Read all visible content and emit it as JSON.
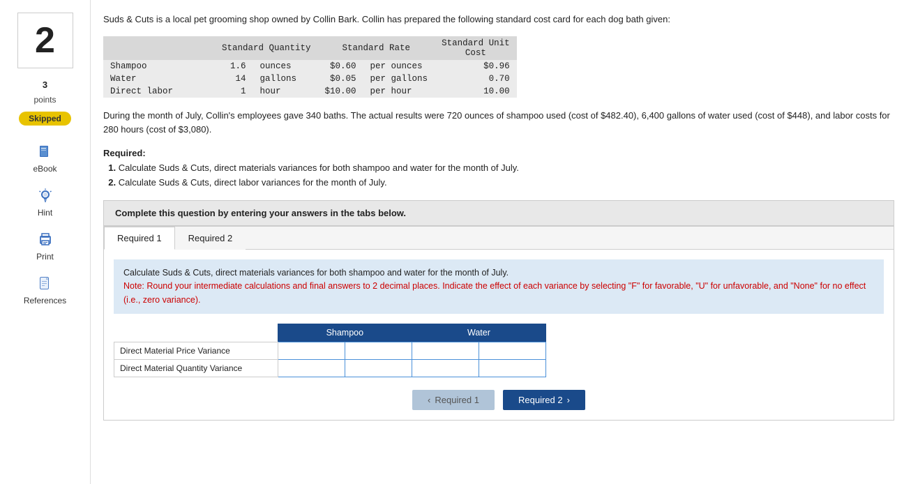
{
  "sidebar": {
    "question_number": "2",
    "points_value": "3",
    "points_label": "points",
    "skipped_label": "Skipped",
    "items": [
      {
        "id": "ebook",
        "label": "eBook",
        "icon": "book-icon"
      },
      {
        "id": "hint",
        "label": "Hint",
        "icon": "lightbulb-icon"
      },
      {
        "id": "print",
        "label": "Print",
        "icon": "print-icon"
      },
      {
        "id": "references",
        "label": "References",
        "icon": "document-icon"
      }
    ]
  },
  "main": {
    "question_text_1": "Suds & Cuts is a local pet grooming shop owned by Collin Bark. Collin has prepared the following standard cost card for each dog bath given:",
    "cost_table": {
      "headers": [
        "",
        "Standard Quantity",
        "",
        "Standard Rate",
        "",
        "Standard Unit Cost"
      ],
      "rows": [
        {
          "item": "Shampoo",
          "quantity": "1.6",
          "unit": "ounces",
          "rate": "$0.60",
          "rate_unit": "per ounces",
          "cost": "$0.96"
        },
        {
          "item": "Water",
          "quantity": "14",
          "unit": "gallons",
          "rate": "$0.05",
          "rate_unit": "per gallons",
          "cost": "0.70"
        },
        {
          "item": "Direct labor",
          "quantity": "1",
          "unit": "hour",
          "rate": "$10.00",
          "rate_unit": "per hour",
          "cost": "10.00"
        }
      ]
    },
    "scenario_text": "During the month of July, Collin's employees gave 340 baths. The actual results were 720 ounces of shampoo used (cost of $482.40), 6,400 gallons of water used (cost of $448), and labor costs for 280 hours (cost of $3,080).",
    "required_title": "Required:",
    "required_items": [
      "Calculate Suds & Cuts, direct materials variances for both shampoo and water for the month of July.",
      "Calculate Suds & Cuts, direct labor variances for the month of July."
    ],
    "complete_banner": "Complete this question by entering your answers in the tabs below.",
    "tabs": [
      {
        "id": "req1",
        "label": "Required 1"
      },
      {
        "id": "req2",
        "label": "Required 2"
      }
    ],
    "active_tab": "req1",
    "tab1": {
      "info_text": "Calculate Suds & Cuts, direct materials variances for both shampoo and water for the month of July.",
      "note_text": "Note: Round your intermediate calculations and final answers to 2 decimal places. Indicate the effect of each variance by selecting \"F\" for favorable, \"U\" for unfavorable, and \"None\" for no effect (i.e., zero variance).",
      "table": {
        "col_shampoo": "Shampoo",
        "col_water": "Water",
        "rows": [
          {
            "label": "Direct Material Price Variance"
          },
          {
            "label": "Direct Material Quantity Variance"
          }
        ]
      }
    },
    "nav": {
      "prev_label": "Required 1",
      "next_label": "Required 2"
    }
  }
}
